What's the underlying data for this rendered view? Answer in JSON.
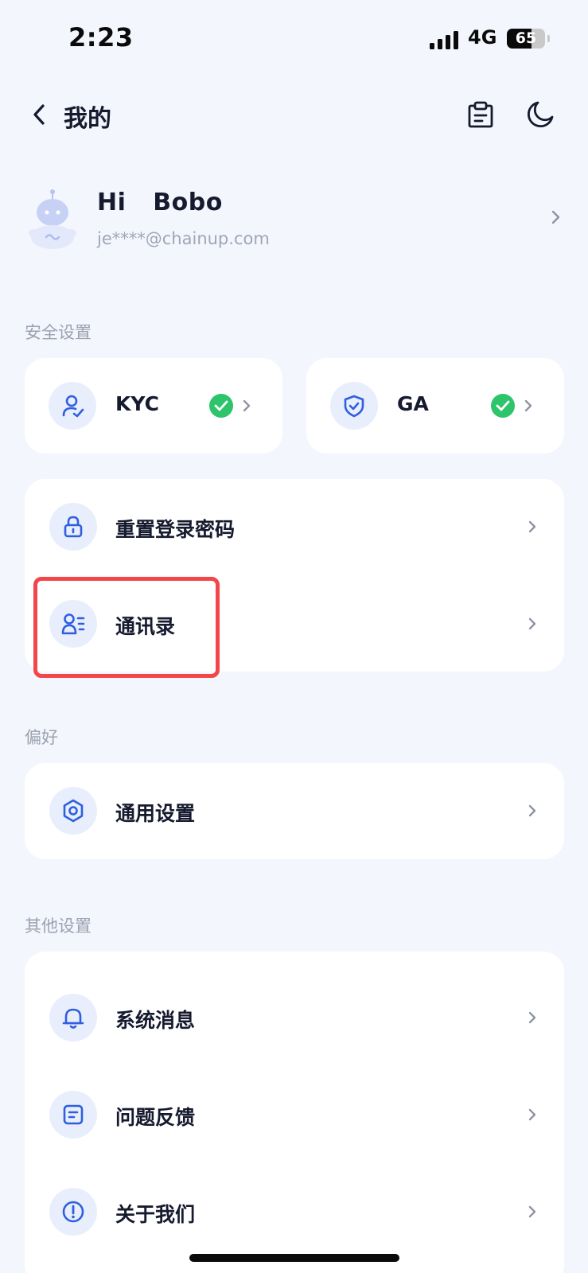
{
  "status_bar": {
    "time": "2:23",
    "network": "4G",
    "battery_level": "65",
    "battery_fraction": 0.65
  },
  "nav": {
    "title": "我的",
    "back_icon": "chevron-left-icon",
    "actions": [
      "clipboard-icon",
      "moon-icon"
    ]
  },
  "profile": {
    "greeting": "Hi  Bobo",
    "email": "je****@chainup.com",
    "avatar_icon": "robot-avatar-icon"
  },
  "security": {
    "section_label": "安全设置",
    "kyc": {
      "label": "KYC",
      "icon": "user-check-icon",
      "verified": true
    },
    "ga": {
      "label": "GA",
      "icon": "shield-check-icon",
      "verified": true
    },
    "items": [
      {
        "label": "重置登录密码",
        "icon": "lock-icon"
      },
      {
        "label": "通讯录",
        "icon": "contacts-icon"
      }
    ]
  },
  "preferences": {
    "section_label": "偏好",
    "items": [
      {
        "label": "通用设置",
        "icon": "settings-hexagon-icon"
      }
    ]
  },
  "other": {
    "section_label": "其他设置",
    "items": [
      {
        "label": "系统消息",
        "icon": "bell-icon"
      },
      {
        "label": "问题反馈",
        "icon": "feedback-icon"
      },
      {
        "label": "关于我们",
        "icon": "info-icon"
      }
    ]
  },
  "colors": {
    "accent": "#2f5fe0",
    "icon_bg": "#e8eefc",
    "background": "#f3f6fc",
    "success": "#2ec46b",
    "highlight": "#f2464b"
  }
}
